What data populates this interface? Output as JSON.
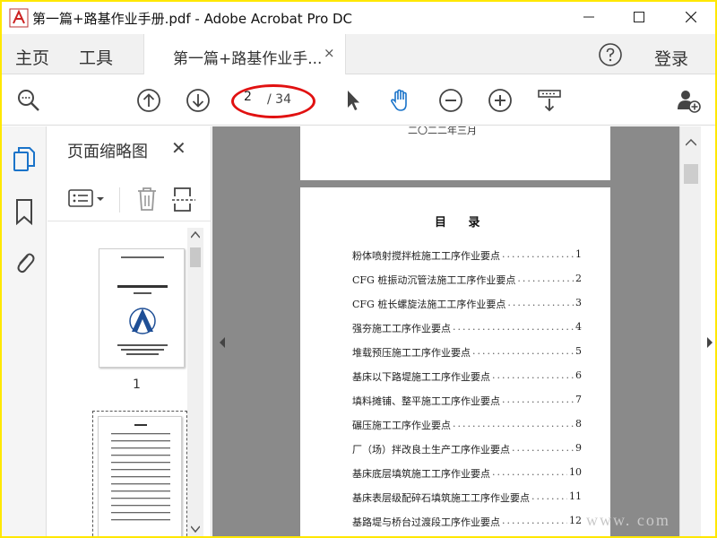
{
  "window": {
    "title": "第一篇+路基作业手册.pdf - Adobe Acrobat Pro DC",
    "min_icon": "minimize-icon",
    "max_icon": "maximize-icon",
    "close_icon": "close-icon"
  },
  "tabbar": {
    "home": "主页",
    "tools": "工具",
    "doc_tab": "第一篇+路基作业手...",
    "doc_tab_close": "×",
    "help": "?",
    "login": "登录"
  },
  "toolbar": {
    "current_page": "2",
    "total_pages": "/ 34",
    "highlight_color": "#e11111"
  },
  "panel": {
    "title": "页面缩略图",
    "close": "✕",
    "thumb1_label": "1"
  },
  "document": {
    "page1_date": "二〇二二年三月",
    "toc_title": "目 录",
    "toc": [
      {
        "text": "粉体喷射搅拌桩施工工序作业要点",
        "page": "1"
      },
      {
        "text": "CFG 桩振动沉管法施工工序作业要点",
        "page": "2"
      },
      {
        "text": "CFG 桩长螺旋法施工工序作业要点",
        "page": "3"
      },
      {
        "text": "强夯施工工序作业要点",
        "page": "4"
      },
      {
        "text": "堆载预压施工工序作业要点",
        "page": "5"
      },
      {
        "text": "基床以下路堤施工工序作业要点",
        "page": "6"
      },
      {
        "text": "填料摊铺、整平施工工序作业要点",
        "page": "7"
      },
      {
        "text": "碾压施工工序作业要点",
        "page": "8"
      },
      {
        "text": "厂（场）拌改良土生产工序作业要点",
        "page": "9"
      },
      {
        "text": "基床底层填筑施工工序作业要点",
        "page": "10"
      },
      {
        "text": "基床表层级配碎石填筑施工工序作业要点",
        "page": "11"
      },
      {
        "text": "基路堤与桥台过渡段工序作业要点",
        "page": "12"
      }
    ]
  },
  "watermark": "www.  com"
}
